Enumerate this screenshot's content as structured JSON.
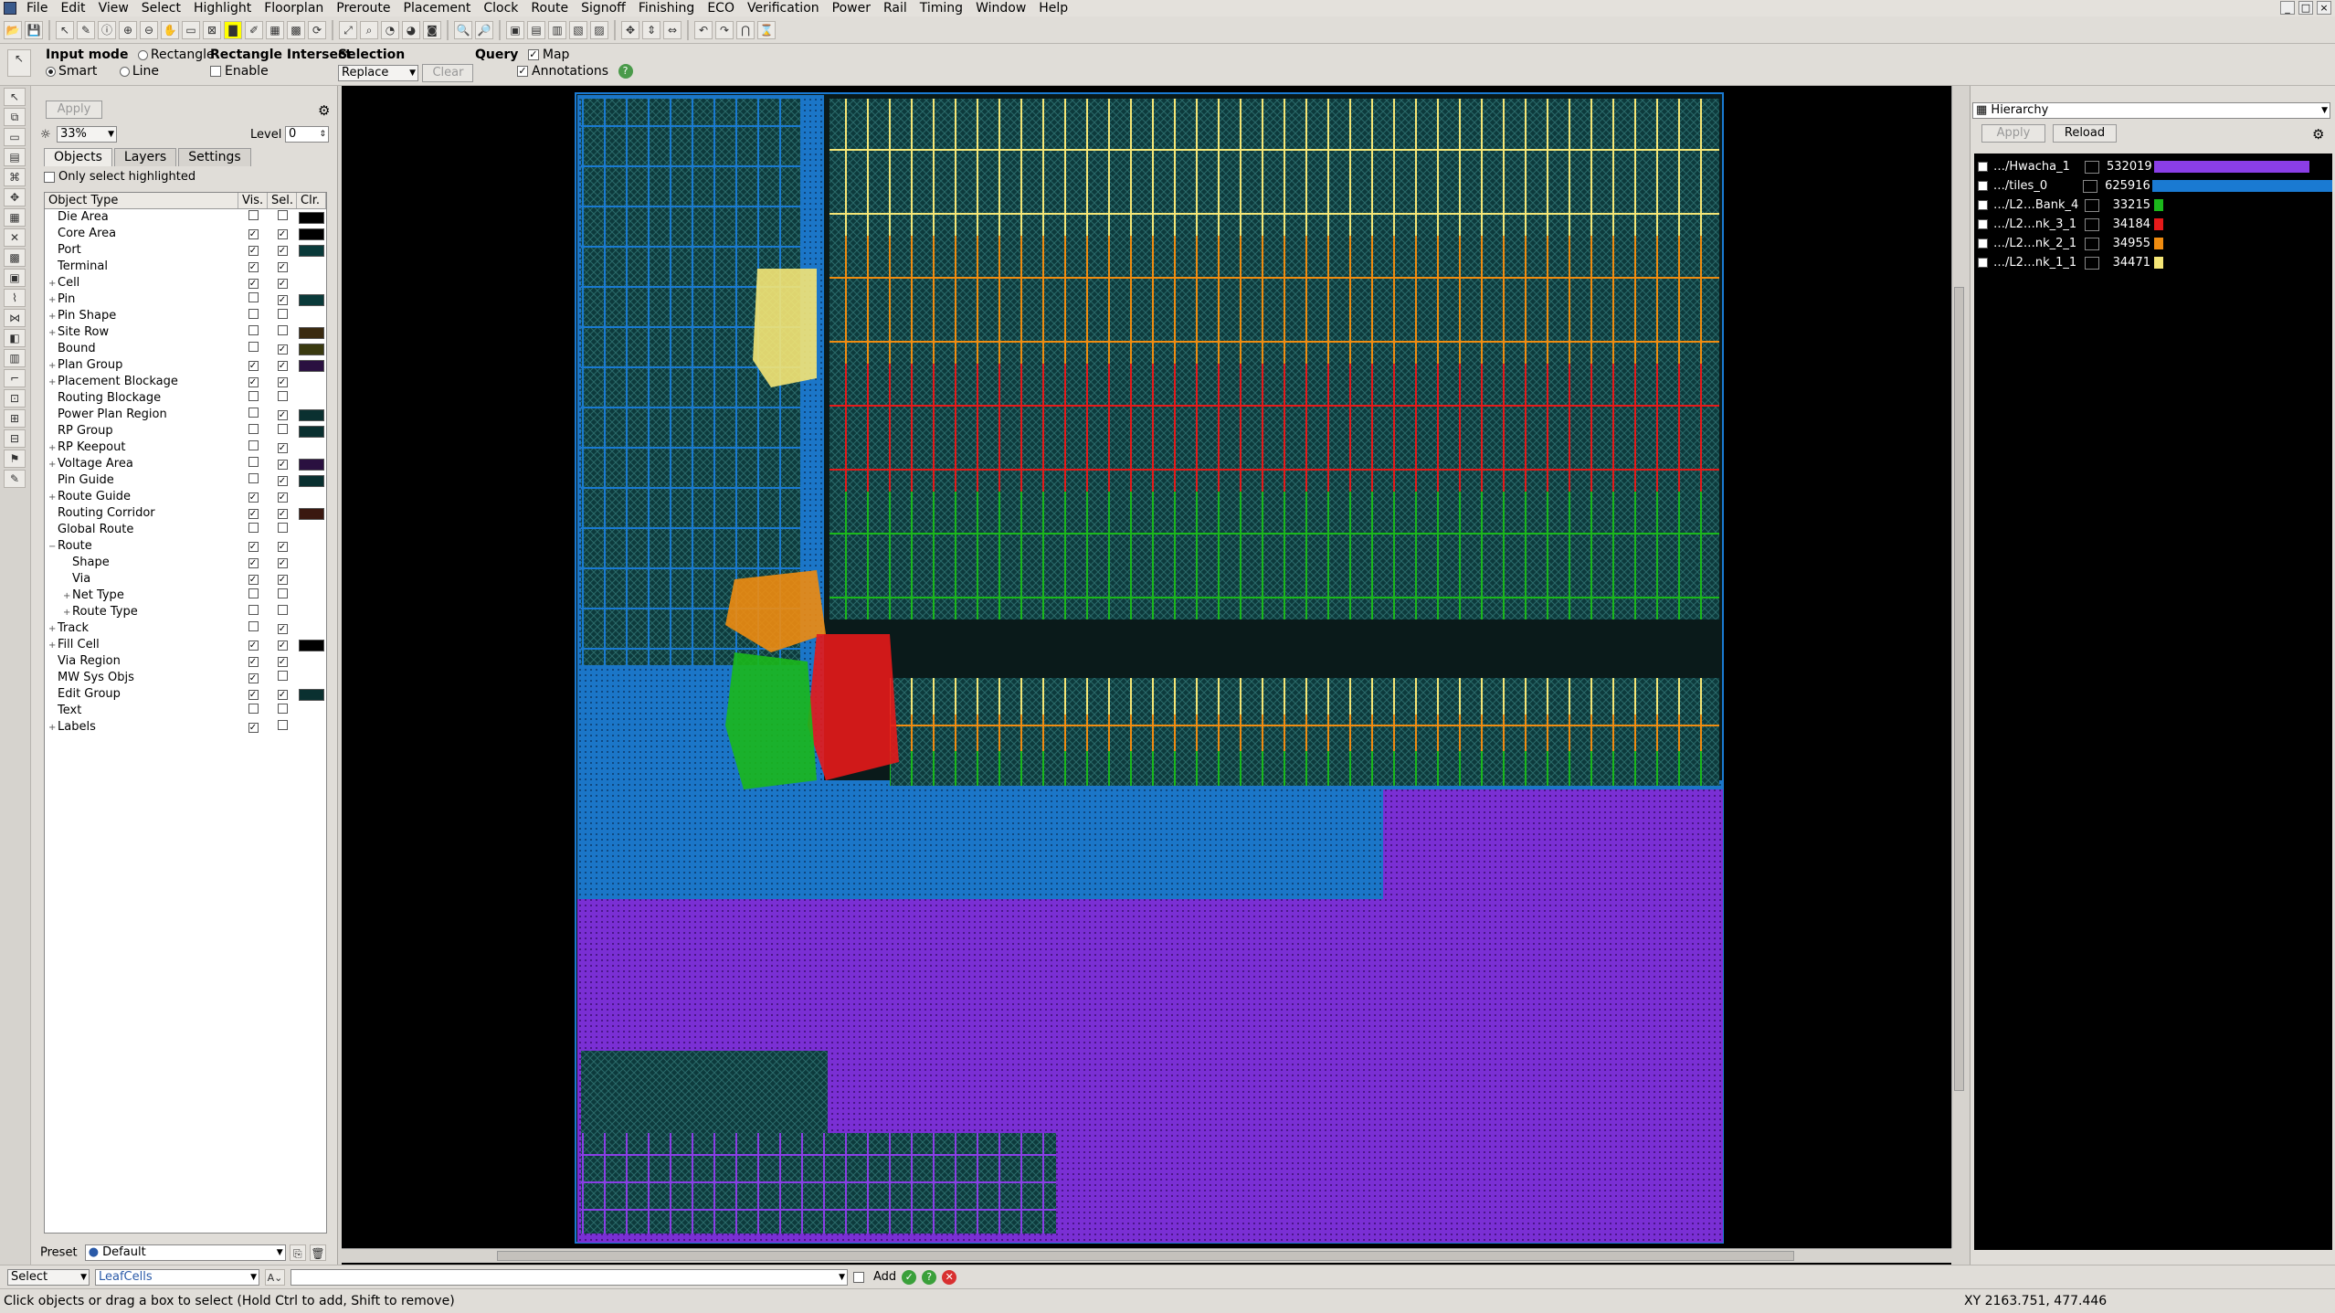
{
  "menu": [
    "File",
    "Edit",
    "View",
    "Select",
    "Highlight",
    "Floorplan",
    "Preroute",
    "Placement",
    "Clock",
    "Route",
    "Signoff",
    "Finishing",
    "ECO",
    "Verification",
    "Power",
    "Rail",
    "Timing",
    "Window",
    "Help"
  ],
  "options": {
    "input_mode_label": "Input mode",
    "rectangle_label": "Rectangle",
    "smart_label": "Smart",
    "line_label": "Line",
    "rect_intersect_label": "Rectangle Intersect",
    "enable_label": "Enable",
    "selection_label": "Selection",
    "selection_value": "Replace",
    "clear_label": "Clear",
    "query_label": "Query",
    "map_label": "Map",
    "annotations_label": "Annotations"
  },
  "leftpanel": {
    "apply_label": "Apply",
    "zoom_value": "33%",
    "level_label": "Level",
    "level_value": "0",
    "tabs": [
      "Objects",
      "Layers",
      "Settings"
    ],
    "only_highlighted_label": "Only select highlighted",
    "col_object": "Object Type",
    "col_vis": "Vis.",
    "col_sel": "Sel.",
    "col_clr": "Clr.",
    "rows": [
      {
        "name": "Die Area",
        "indent": 0,
        "ex": "",
        "vis": "",
        "sel": "",
        "clr": "#000000"
      },
      {
        "name": "Core Area",
        "indent": 0,
        "ex": "",
        "vis": "✓",
        "sel": "✓",
        "clr": "#000000"
      },
      {
        "name": "Port",
        "indent": 0,
        "ex": "",
        "vis": "✓",
        "sel": "✓",
        "clr": "#0a3a3a"
      },
      {
        "name": "Terminal",
        "indent": 0,
        "ex": "",
        "vis": "✓",
        "sel": "✓",
        "clr": ""
      },
      {
        "name": "Cell",
        "indent": 0,
        "ex": "+",
        "vis": "✓",
        "sel": "✓",
        "clr": ""
      },
      {
        "name": "Pin",
        "indent": 0,
        "ex": "+",
        "vis": "",
        "sel": "✓",
        "clr": "#0a3a3a"
      },
      {
        "name": "Pin Shape",
        "indent": 0,
        "ex": "+",
        "vis": "",
        "sel": "",
        "clr": ""
      },
      {
        "name": "Site Row",
        "indent": 0,
        "ex": "+",
        "vis": "",
        "sel": "",
        "clr": "#3a2a10"
      },
      {
        "name": "Bound",
        "indent": 0,
        "ex": "",
        "vis": "",
        "sel": "✓",
        "clr": "#3a3a10"
      },
      {
        "name": "Plan Group",
        "indent": 0,
        "ex": "+",
        "vis": "✓",
        "sel": "✓",
        "clr": "#2a1040"
      },
      {
        "name": "Placement Blockage",
        "indent": 0,
        "ex": "+",
        "vis": "✓",
        "sel": "✓",
        "clr": ""
      },
      {
        "name": "Routing Blockage",
        "indent": 0,
        "ex": "",
        "vis": "",
        "sel": "",
        "clr": ""
      },
      {
        "name": "Power Plan Region",
        "indent": 0,
        "ex": "",
        "vis": "",
        "sel": "✓",
        "clr": "#0a3030"
      },
      {
        "name": "RP Group",
        "indent": 0,
        "ex": "",
        "vis": "",
        "sel": "",
        "clr": "#0a3030"
      },
      {
        "name": "RP Keepout",
        "indent": 0,
        "ex": "+",
        "vis": "",
        "sel": "✓",
        "clr": ""
      },
      {
        "name": "Voltage Area",
        "indent": 0,
        "ex": "+",
        "vis": "",
        "sel": "✓",
        "clr": "#2a1040"
      },
      {
        "name": "Pin Guide",
        "indent": 0,
        "ex": "",
        "vis": "",
        "sel": "✓",
        "clr": "#0a3030"
      },
      {
        "name": "Route Guide",
        "indent": 0,
        "ex": "+",
        "vis": "✓",
        "sel": "✓",
        "clr": ""
      },
      {
        "name": "Routing Corridor",
        "indent": 0,
        "ex": "",
        "vis": "✓",
        "sel": "✓",
        "clr": "#3a1810"
      },
      {
        "name": "Global Route",
        "indent": 0,
        "ex": "",
        "vis": "",
        "sel": "",
        "clr": ""
      },
      {
        "name": "Route",
        "indent": 0,
        "ex": "−",
        "vis": "✓",
        "sel": "✓",
        "clr": ""
      },
      {
        "name": "Shape",
        "indent": 1,
        "ex": "",
        "vis": "✓",
        "sel": "✓",
        "clr": ""
      },
      {
        "name": "Via",
        "indent": 1,
        "ex": "",
        "vis": "✓",
        "sel": "✓",
        "clr": ""
      },
      {
        "name": "Net Type",
        "indent": 1,
        "ex": "+",
        "vis": "",
        "sel": "",
        "clr": ""
      },
      {
        "name": "Route Type",
        "indent": 1,
        "ex": "+",
        "vis": "",
        "sel": "",
        "clr": ""
      },
      {
        "name": "Track",
        "indent": 0,
        "ex": "+",
        "vis": "",
        "sel": "✓",
        "clr": ""
      },
      {
        "name": "Fill Cell",
        "indent": 0,
        "ex": "+",
        "vis": "✓",
        "sel": "✓",
        "clr": "#000000"
      },
      {
        "name": "Via Region",
        "indent": 0,
        "ex": "",
        "vis": "✓",
        "sel": "✓",
        "clr": ""
      },
      {
        "name": "MW Sys Objs",
        "indent": 0,
        "ex": "",
        "vis": "✓",
        "sel": "",
        "clr": ""
      },
      {
        "name": "Edit Group",
        "indent": 0,
        "ex": "",
        "vis": "✓",
        "sel": "✓",
        "clr": "#0a3030"
      },
      {
        "name": "Text",
        "indent": 0,
        "ex": "",
        "vis": "",
        "sel": "",
        "clr": ""
      },
      {
        "name": "Labels",
        "indent": 0,
        "ex": "+",
        "vis": "✓",
        "sel": "",
        "clr": ""
      }
    ],
    "preset_label": "Preset",
    "preset_value": "Default"
  },
  "rightpanel": {
    "view_value": "Hierarchy",
    "apply_label": "Apply",
    "reload_label": "Reload",
    "rows": [
      {
        "name": "…/Hwacha_1",
        "value": "532019",
        "color": "#8a3ee6",
        "frac": 0.85
      },
      {
        "name": "…/tiles_0",
        "value": "625916",
        "color": "#1a7ad2",
        "frac": 1.0
      },
      {
        "name": "…/L2…Bank_4",
        "value": "33215",
        "color": "#1bb81b",
        "frac": 0.05
      },
      {
        "name": "…/L2…nk_3_1",
        "value": "34184",
        "color": "#e51a1a",
        "frac": 0.05
      },
      {
        "name": "…/L2…nk_2_1",
        "value": "34955",
        "color": "#f08c10",
        "frac": 0.05
      },
      {
        "name": "…/L2…nk_1_1",
        "value": "34471",
        "color": "#f5e676",
        "frac": 0.05
      }
    ]
  },
  "cmdbar": {
    "mode_value": "Select",
    "filter_value": "LeafCells",
    "add_label": "Add"
  },
  "status": {
    "hint": "Click objects or drag a box to select (Hold Ctrl to add, Shift to remove)",
    "coords": "XY 2163.751, 477.446"
  }
}
